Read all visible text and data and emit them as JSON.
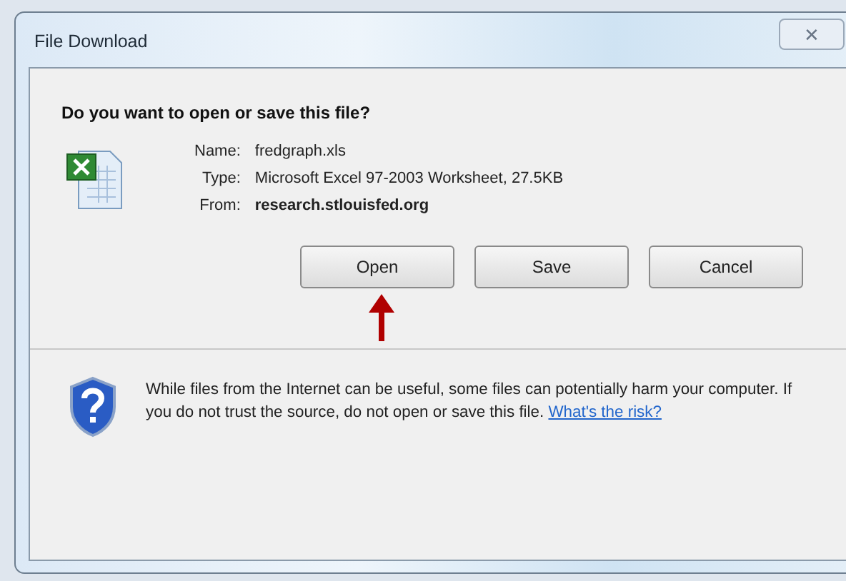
{
  "window": {
    "title": "File Download",
    "close": "✕"
  },
  "question": "Do you want to open or save this file?",
  "details": [
    {
      "label": "Name:",
      "value": "fredgraph.xls",
      "bold": false
    },
    {
      "label": "Type:",
      "value": "Microsoft Excel 97-2003 Worksheet, 27.5KB",
      "bold": false
    },
    {
      "label": "From:",
      "value": "research.stlouisfed.org",
      "bold": true
    }
  ],
  "buttons": [
    "Open",
    "Save",
    "Cancel"
  ],
  "warning": {
    "text": "While files from the Internet can be useful, some files can potentially harm your computer. If you do not trust the source, do not open or save this file.",
    "link": "What's the risk?"
  }
}
